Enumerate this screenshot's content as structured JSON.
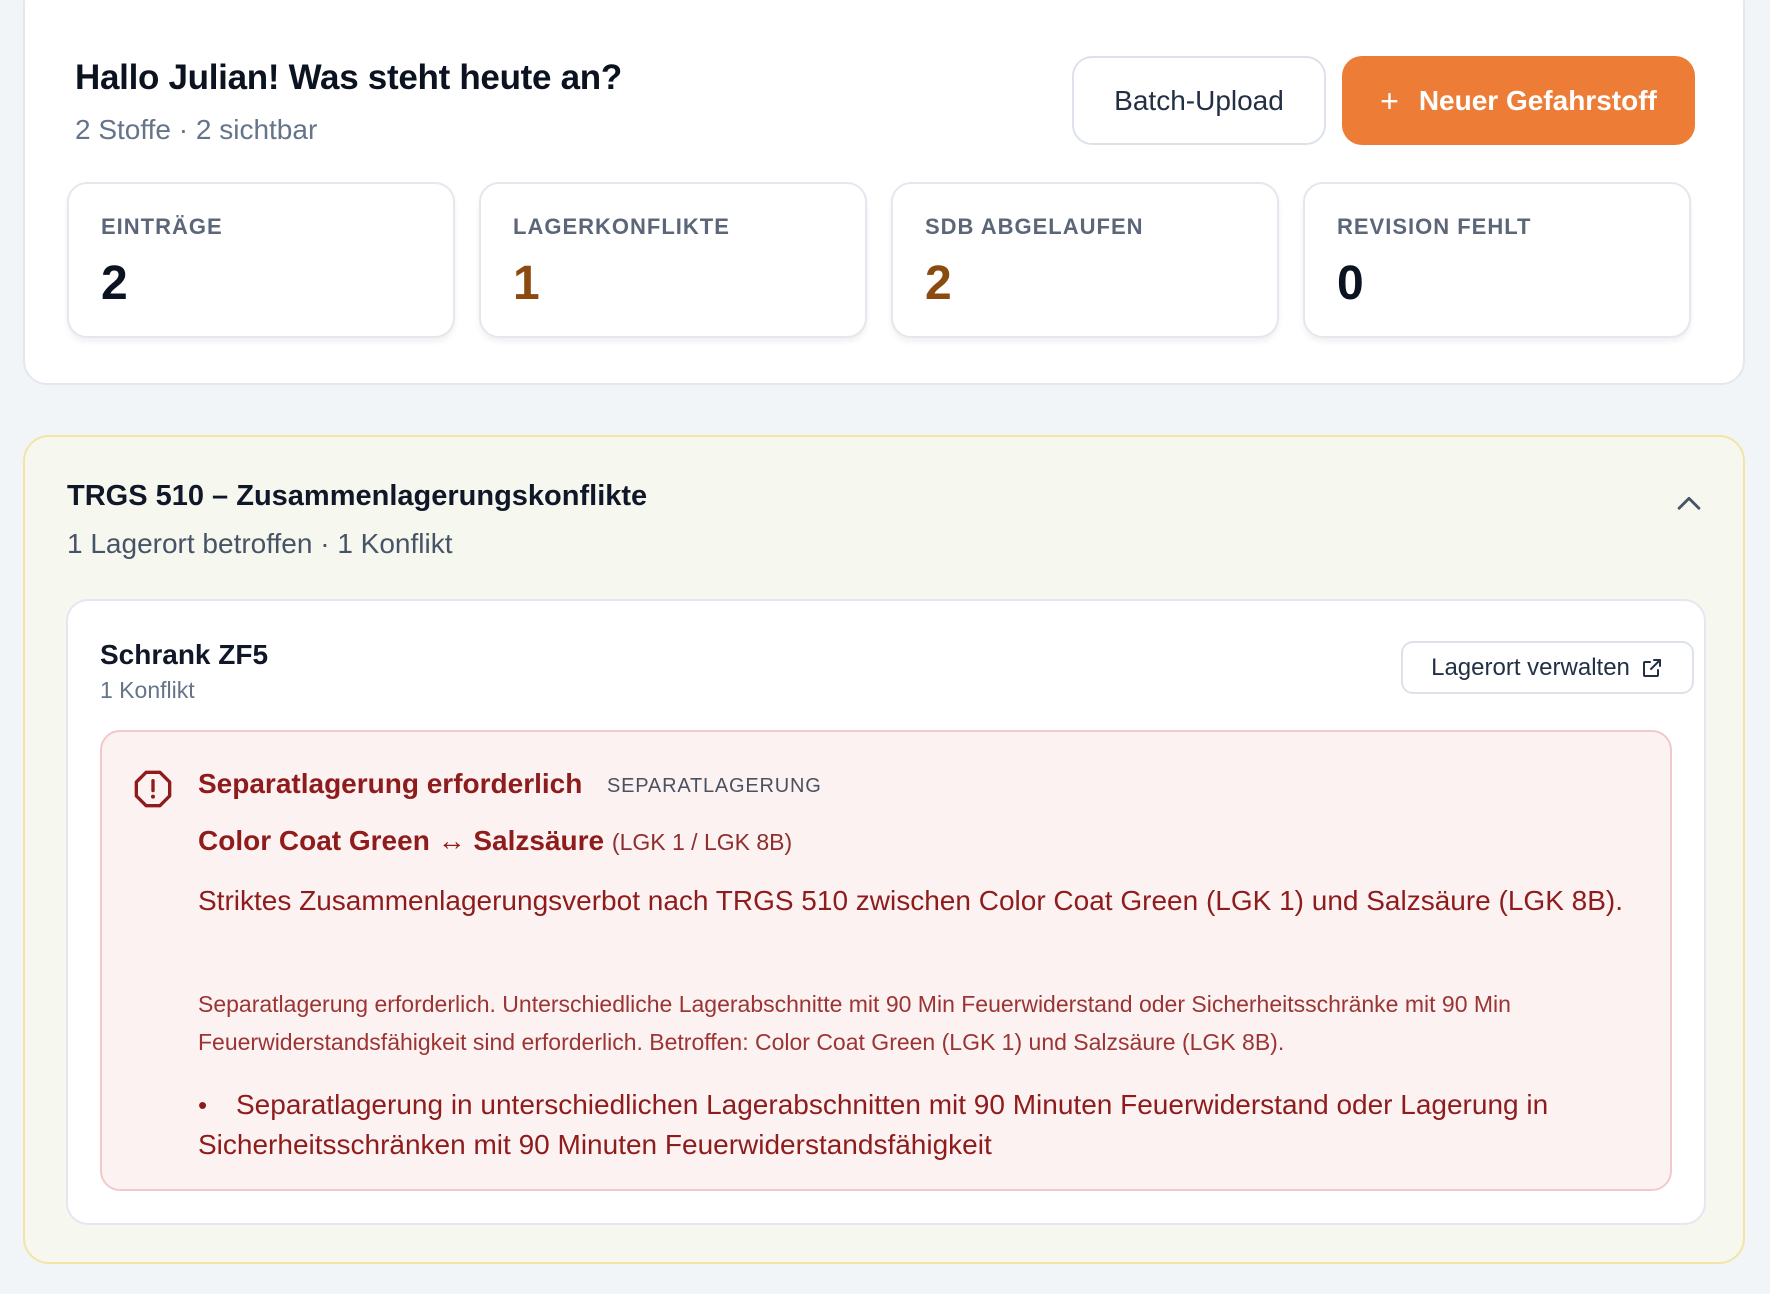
{
  "header": {
    "greeting": "Hallo Julian! Was steht heute an?",
    "subline": "2 Stoffe · 2 sichtbar",
    "batch_upload_label": "Batch-Upload",
    "new_substance_label": "Neuer Gefahrstoff"
  },
  "stats": [
    {
      "label": "EINTRÄGE",
      "value": "2",
      "color": "#0b1220"
    },
    {
      "label": "LAGERKONFLIKTE",
      "value": "1",
      "color": "#8a4a10"
    },
    {
      "label": "SDB ABGELAUFEN",
      "value": "2",
      "color": "#8a4a10"
    },
    {
      "label": "REVISION FEHLT",
      "value": "0",
      "color": "#0b1220"
    }
  ],
  "trgs": {
    "title": "TRGS 510 – Zusammenlagerungskonflikte",
    "subtitle": "1 Lagerort betroffen · 1 Konflikt",
    "location": {
      "name": "Schrank ZF5",
      "count": "1 Konflikt",
      "manage_label": "Lagerort verwalten",
      "conflict": {
        "title": "Separatlagerung erforderlich",
        "tag": "SEPARATLAGERUNG",
        "substance_a": "Color Coat Green",
        "arrow": "↔",
        "substance_b": "Salzsäure",
        "lgk": "(LGK 1 / LGK 8B)",
        "main_text": "Striktes Zusammenlagerungsverbot nach TRGS 510 zwischen Color Coat Green (LGK 1) und Salzsäure (LGK 8B).",
        "detail_text": "Separatlagerung erforderlich. Unterschiedliche Lagerabschnitte mit 90 Min Feuerwiderstand oder Sicherheitsschränke mit 90 Min Feuerwiderstandsfähigkeit sind erforderlich. Betroffen: Color Coat Green (LGK 1) und Salzsäure (LGK 8B).",
        "bullet": "•",
        "measures": [
          "Separatlagerung in unterschiedlichen Lagerabschnitten mit 90 Minuten Feuerwiderstand oder Lagerung in Sicherheitsschränken mit 90 Minuten Feuerwiderstandsfähigkeit"
        ]
      }
    }
  },
  "colors": {
    "accent_orange": "#ec7c36",
    "alert_red": "#8e1c1c",
    "warning_brown": "#8a4a10",
    "section_border": "#f3e4a6"
  },
  "icons": {
    "plus": "plus-icon",
    "chevron": "chevron-up-icon",
    "external": "external-link-icon",
    "alert": "alert-octagon-icon"
  }
}
